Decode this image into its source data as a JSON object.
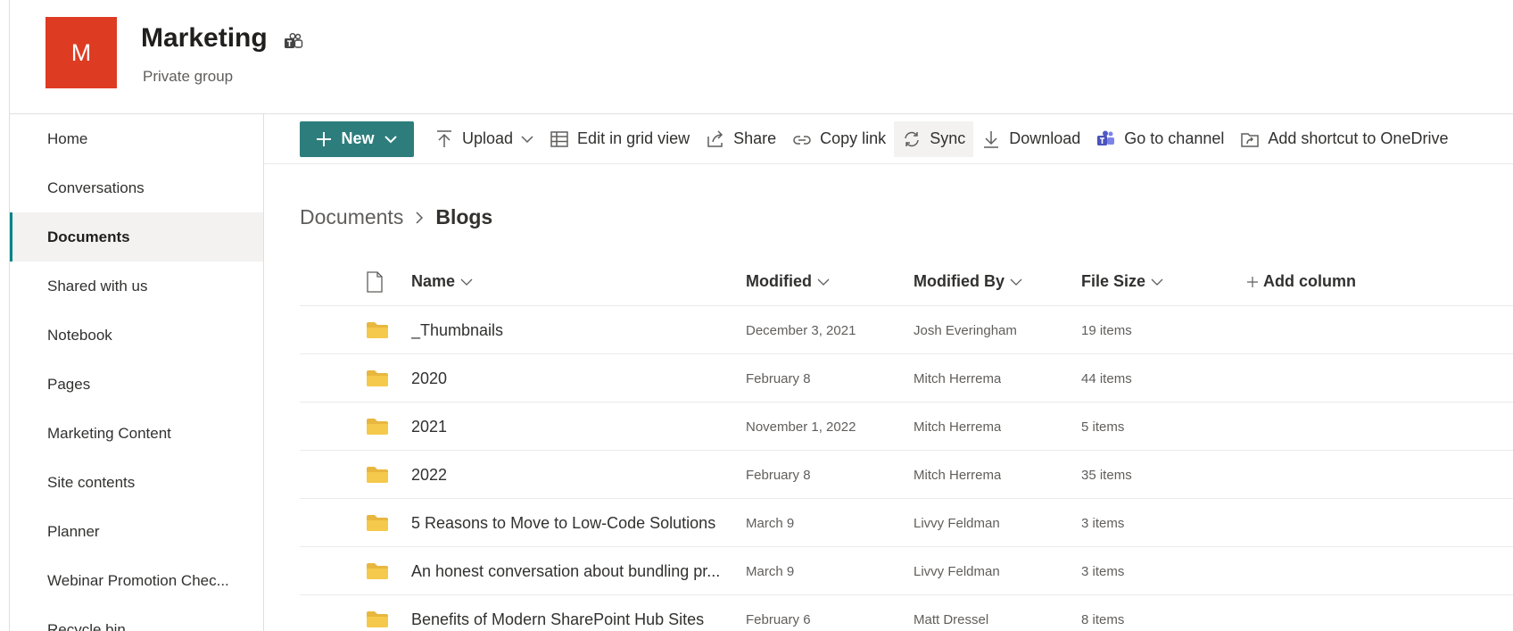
{
  "site": {
    "logo_letter": "M",
    "title": "Marketing",
    "subtitle": "Private group",
    "brand_color": "#de3b23",
    "teams_icon": "teams-icon"
  },
  "nav": {
    "items": [
      {
        "label": "Home",
        "active": false
      },
      {
        "label": "Conversations",
        "active": false
      },
      {
        "label": "Documents",
        "active": true
      },
      {
        "label": "Shared with us",
        "active": false
      },
      {
        "label": "Notebook",
        "active": false
      },
      {
        "label": "Pages",
        "active": false
      },
      {
        "label": "Marketing Content",
        "active": false
      },
      {
        "label": "Site contents",
        "active": false
      },
      {
        "label": "Planner",
        "active": false
      },
      {
        "label": "Webinar Promotion Chec...",
        "active": false
      },
      {
        "label": "Recycle bin",
        "active": false
      }
    ],
    "accent_color": "#038387"
  },
  "commandbar": {
    "new_label": "New",
    "upload_label": "Upload",
    "grid_label": "Edit in grid view",
    "share_label": "Share",
    "copy_link_label": "Copy link",
    "sync_label": "Sync",
    "download_label": "Download",
    "channel_label": "Go to channel",
    "shortcut_label": "Add shortcut to OneDrive",
    "new_button_color": "#2e7d7d"
  },
  "breadcrumb": {
    "parent": "Documents",
    "current": "Blogs"
  },
  "table": {
    "columns": {
      "name": "Name",
      "modified": "Modified",
      "modified_by": "Modified By",
      "file_size": "File Size",
      "add_column": "Add column"
    },
    "rows": [
      {
        "name": "_Thumbnails",
        "modified": "December 3, 2021",
        "modified_by": "Josh Everingham",
        "size": "19 items"
      },
      {
        "name": "2020",
        "modified": "February 8",
        "modified_by": "Mitch Herrema",
        "size": "44 items"
      },
      {
        "name": "2021",
        "modified": "November 1, 2022",
        "modified_by": "Mitch Herrema",
        "size": "5 items"
      },
      {
        "name": "2022",
        "modified": "February 8",
        "modified_by": "Mitch Herrema",
        "size": "35 items"
      },
      {
        "name": "5 Reasons to Move to Low-Code Solutions",
        "modified": "March 9",
        "modified_by": "Livvy Feldman",
        "size": "3 items"
      },
      {
        "name": "An honest conversation about bundling pr...",
        "modified": "March 9",
        "modified_by": "Livvy Feldman",
        "size": "3 items"
      },
      {
        "name": "Benefits of Modern SharePoint Hub Sites",
        "modified": "February 6",
        "modified_by": "Matt Dressel",
        "size": "8 items"
      }
    ],
    "folder_color": "#f5c94c"
  }
}
